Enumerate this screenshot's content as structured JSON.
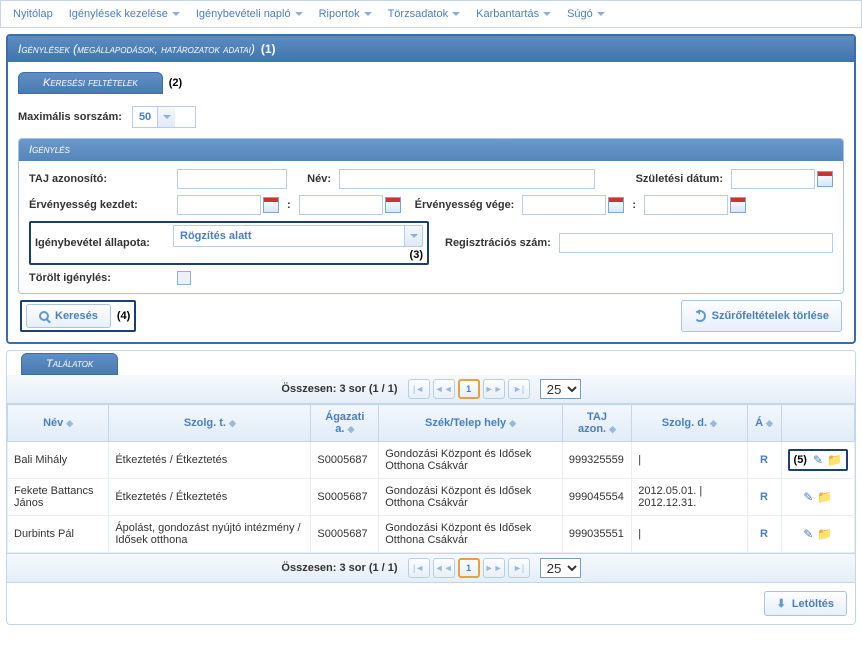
{
  "menu": {
    "items": [
      {
        "label": "Nyitólap",
        "caret": false
      },
      {
        "label": "Igénylések kezelése",
        "caret": true
      },
      {
        "label": "Igénybevételi napló",
        "caret": true
      },
      {
        "label": "Riportok",
        "caret": true
      },
      {
        "label": "Törzsadatok",
        "caret": true
      },
      {
        "label": "Karbantartás",
        "caret": true
      },
      {
        "label": "Súgó",
        "caret": true
      }
    ]
  },
  "main": {
    "title": "Igénylések (megállapodások, határozatok adatai)",
    "title_annot": "(1)"
  },
  "search": {
    "tab_label": "Keresési feltételek",
    "tab_annot": "(2)",
    "max_sorszam_label": "Maximális sorszám:",
    "max_sorszam_value": "50",
    "sub_title": "Igénylés",
    "taj_label": "TAJ azonosító:",
    "nev_label": "Név:",
    "szul_label": "Születési dátum:",
    "erv_kezdet_label": "Érvényesség kezdet:",
    "colon": ":",
    "erv_vege_label": "Érvényesség vége:",
    "allapot_label": "Igénybevétel állapota:",
    "allapot_value": "Rögzítés alatt",
    "allapot_annot": "(3)",
    "reg_label": "Regisztrációs szám:",
    "torolt_label": "Törölt igénylés:",
    "kereses_btn": "Keresés",
    "kereses_annot": "(4)",
    "torles_btn": "Szűrőfeltételek törlése"
  },
  "results": {
    "tab_label": "Találatok",
    "summary": "Összesen: 3 sor (1 / 1)",
    "page_current": "1",
    "page_size": "25",
    "headers": {
      "nev": "Név",
      "szolg_t": "Szolg. t.",
      "agazati": "Ágazati a.",
      "hely": "Szék/Telep hely",
      "taj": "TAJ azon.",
      "szolg_d": "Szolg. d.",
      "a": "Á",
      "act": ""
    },
    "rows": [
      {
        "nev": "Bali Mihály",
        "szolg_t": "Étkeztetés / Étkeztetés",
        "agazati": "S0005687",
        "hely": "Gondozási Központ és Idősek Otthona Csákvár",
        "taj": "999325559",
        "szolg_d": "|",
        "a": "R",
        "annot": "(5)"
      },
      {
        "nev": "Fekete Battancs János",
        "szolg_t": "Étkeztetés / Étkeztetés",
        "agazati": "S0005687",
        "hely": "Gondozási Központ és Idősek Otthona Csákvár",
        "taj": "999045554",
        "szolg_d": "2012.05.01. | 2012.12.31.",
        "a": "R",
        "annot": ""
      },
      {
        "nev": "Durbints Pál",
        "szolg_t": "Ápolást, gondozást nyújtó intézmény / Idősek otthona",
        "agazati": "S0005687",
        "hely": "Gondozási Központ és Idősek Otthona Csákvár",
        "taj": "999035551",
        "szolg_d": "|",
        "a": "R",
        "annot": ""
      }
    ],
    "download_btn": "Letöltés"
  }
}
